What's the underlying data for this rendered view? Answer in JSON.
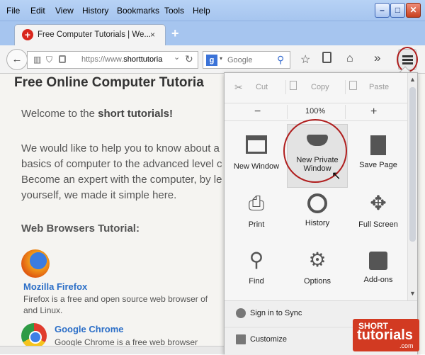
{
  "menubar": {
    "items": [
      "File",
      "Edit",
      "View",
      "History",
      "Bookmarks",
      "Tools",
      "Help"
    ]
  },
  "window_controls": {
    "minimize": "–",
    "maximize": "□",
    "close": "✕"
  },
  "tab": {
    "title": "Free Computer Tutorials | We...",
    "close": "×",
    "new_tab": "+"
  },
  "navbar": {
    "url_prefix": "https://www.",
    "url_domain": "shorttutoria",
    "search_placeholder": "Google",
    "search_engine_letter": "g"
  },
  "page": {
    "heading": "Free Online Computer Tutoria",
    "welcome_plain": "Welcome to the ",
    "welcome_bold": "short tutorials!",
    "para": [
      "We would like to help you to know about a",
      "basics of computer to the advanced level c",
      "Become an expert with the computer, by le",
      "yourself, we made it simple here."
    ],
    "section": "Web Browsers Tutorial:",
    "firefox": {
      "name": "Mozilla Firefox",
      "desc": [
        "Firefox is a free and open source web browser of",
        "and Linux."
      ]
    },
    "chrome": {
      "name": "Google Chrome",
      "desc": "Google Chrome is a free web browser"
    }
  },
  "menu": {
    "edit": {
      "cut": "Cut",
      "copy": "Copy",
      "paste": "Paste"
    },
    "zoom": {
      "minus": "−",
      "value": "100%",
      "plus": "+"
    },
    "items": [
      {
        "label": "New Window",
        "icon": "new-window-icon"
      },
      {
        "label": "New Private Window",
        "icon": "mask-icon"
      },
      {
        "label": "Save Page",
        "icon": "save-page-icon"
      },
      {
        "label": "Print",
        "icon": "printer-icon"
      },
      {
        "label": "History",
        "icon": "clock-icon"
      },
      {
        "label": "Full Screen",
        "icon": "fullscreen-icon"
      },
      {
        "label": "Find",
        "icon": "magnifier-icon"
      },
      {
        "label": "Options",
        "icon": "gear-icon"
      },
      {
        "label": "Add-ons",
        "icon": "puzzle-icon"
      }
    ],
    "sync": "Sign in to Sync",
    "customize": "Customize"
  },
  "brand": {
    "line1": "SHORT",
    "line2": "tutorials",
    "line3": ".com"
  },
  "colors": {
    "accent": "#b01e1e",
    "menubar": "#a6c5ef",
    "link": "#2b6ec7",
    "brand": "#d23a22"
  }
}
